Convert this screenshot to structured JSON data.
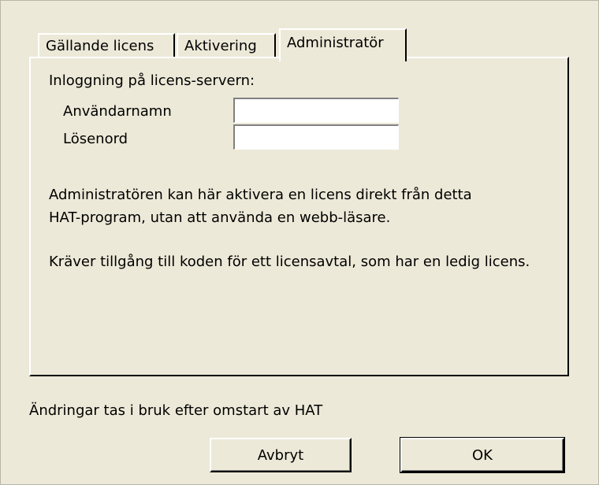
{
  "tabs": [
    {
      "label": "Gällande licens",
      "active": false
    },
    {
      "label": "Aktivering",
      "active": false
    },
    {
      "label": "Administratör",
      "active": true
    }
  ],
  "panel": {
    "login_heading": "Inloggning på licens-servern:",
    "username_label": "Användarnamn",
    "password_label": "Lösenord",
    "username_value": "",
    "password_value": "",
    "description_line_1": "Administratören kan här aktivera en licens direkt från detta",
    "description_line_2": "HAT-program, utan att använda en webb-läsare.",
    "description_line_3": "Kräver tillgång till koden för ett licensavtal, som har en ledig licens."
  },
  "footer_note": "Ändringar tas i bruk efter omstart av HAT",
  "buttons": {
    "cancel_label": "Avbryt",
    "ok_label": "OK"
  },
  "colors": {
    "dialog_background": "#ece9d8",
    "input_background": "#ffffff"
  }
}
